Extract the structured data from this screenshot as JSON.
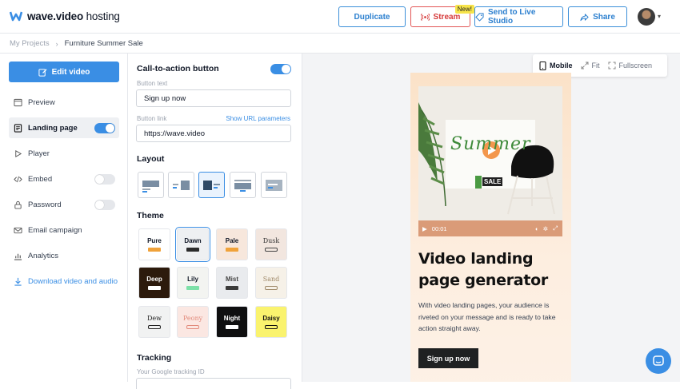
{
  "app": {
    "logo_brand": "wave.video",
    "logo_suffix": " hosting"
  },
  "topbar": {
    "duplicate_label": "Duplicate",
    "stream_label": "Stream",
    "new_badge": "New!",
    "live_studio_label": "Send to Live Studio",
    "share_label": "Share"
  },
  "breadcrumb": {
    "root": "My Projects",
    "current": "Furniture Summer Sale"
  },
  "sidebar": {
    "edit_label": "Edit video",
    "items": [
      {
        "label": "Preview",
        "icon": "preview-icon"
      },
      {
        "label": "Landing page",
        "icon": "landing-page-icon",
        "toggle": true,
        "active": true
      },
      {
        "label": "Player",
        "icon": "play-icon"
      },
      {
        "label": "Embed",
        "icon": "code-icon",
        "toggle": false
      },
      {
        "label": "Password",
        "icon": "lock-icon",
        "toggle": false
      },
      {
        "label": "Email campaign",
        "icon": "mail-icon"
      },
      {
        "label": "Analytics",
        "icon": "chart-icon"
      },
      {
        "label": "Download video and audio",
        "icon": "download-icon"
      }
    ]
  },
  "panel": {
    "cta_title": "Call-to-action button",
    "cta_enabled": true,
    "button_text_label": "Button text",
    "button_text_value": "Sign up now",
    "button_link_label": "Button link",
    "show_url_params": "Show URL parameters",
    "button_link_value": "https://wave.video",
    "layout_title": "Layout",
    "selected_layout": 3,
    "theme_title": "Theme",
    "themes": [
      {
        "name": "Pure",
        "bg": "#ffffff",
        "fg": "#111827",
        "swatch": "#f0a23a",
        "outline": false
      },
      {
        "name": "Dawn",
        "bg": "#eef0f2",
        "fg": "#111827",
        "swatch": "#2b2b2b",
        "outline": false,
        "selected": true
      },
      {
        "name": "Pale",
        "bg": "#f7e7dc",
        "fg": "#111827",
        "swatch": "#f0a23a",
        "outline": false
      },
      {
        "name": "Dusk",
        "bg": "#f2e6df",
        "fg": "#333333",
        "swatch": "#444444",
        "outline": true
      },
      {
        "name": "Deep",
        "bg": "#2c1a0c",
        "fg": "#ffffff",
        "swatch": "#ffffff",
        "outline": false
      },
      {
        "name": "Lily",
        "bg": "#f3f4f1",
        "fg": "#111827",
        "swatch": "#7de0a8",
        "outline": false
      },
      {
        "name": "Mist",
        "bg": "#e9ebee",
        "fg": "#444444",
        "swatch": "#3a3a3a",
        "outline": false
      },
      {
        "name": "Sand",
        "bg": "#f6f1e8",
        "fg": "#a08a6a",
        "swatch": "#a08a6a",
        "outline": true
      },
      {
        "name": "Dew",
        "bg": "#f1f2f2",
        "fg": "#222222",
        "swatch": "#222222",
        "outline": true
      },
      {
        "name": "Peony",
        "bg": "#fbe7e2",
        "fg": "#e28b7c",
        "swatch": "#e28b7c",
        "outline": true
      },
      {
        "name": "Night",
        "bg": "#0f0f10",
        "fg": "#ffffff",
        "swatch": "#ffffff",
        "outline": false
      },
      {
        "name": "Daisy",
        "bg": "#faf36e",
        "fg": "#111111",
        "swatch": "#111111",
        "outline": true
      }
    ],
    "tracking_title": "Tracking",
    "tracking_label": "Your Google tracking ID"
  },
  "preview": {
    "mobile_label": "Mobile",
    "fit_label": "Fit",
    "fullscreen_label": "Fullscreen",
    "video_time": "00:01",
    "video_title_art": "Summer",
    "sale_tag": "SALE",
    "headline": "Video landing page generator",
    "paragraph": "With video landing pages, your audience is riveted on your message and is ready to take action straight away.",
    "cta_label": "Sign up now"
  },
  "colors": {
    "accent": "#3a8ee4",
    "stream": "#e25656",
    "badge": "#f7e44a"
  }
}
